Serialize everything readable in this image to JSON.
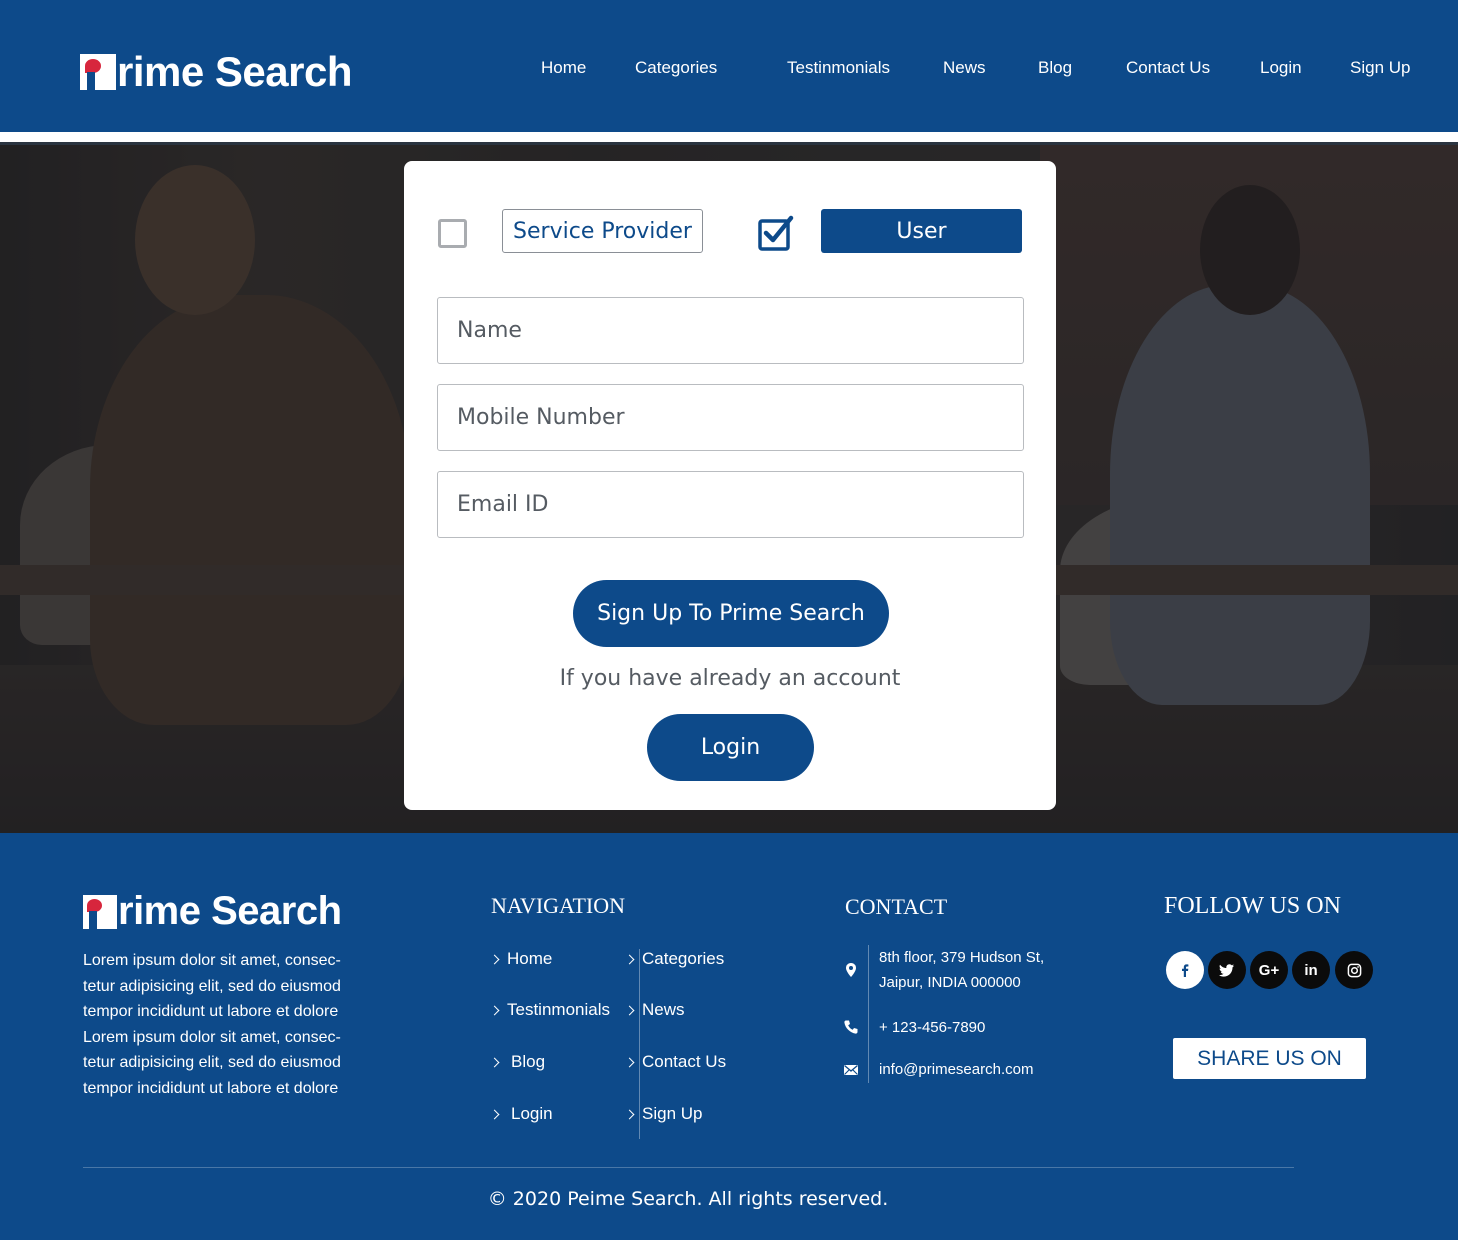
{
  "brand": {
    "name": "rime Search",
    "initial": "P"
  },
  "nav": {
    "home": "Home",
    "categories": "Categories",
    "testimonials": "Testinmonials",
    "news": "News",
    "blog": "Blog",
    "contact": "Contact Us",
    "login": "Login",
    "signup": "Sign Up"
  },
  "form": {
    "role_provider": "Service Provider",
    "role_user": "User",
    "provider_checked": false,
    "user_checked": true,
    "name_placeholder": "Name",
    "mobile_placeholder": "Mobile Number",
    "email_placeholder": "Email ID",
    "signup_button": "Sign Up To Prime Search",
    "already_text": "If you have already an account",
    "login_button": "Login"
  },
  "footer": {
    "about_lines": [
      "Lorem ipsum dolor sit amet, consec-",
      "tetur adipisicing elit, sed do eiusmod",
      "tempor incididunt ut labore et dolore",
      "Lorem ipsum dolor sit amet, consec-",
      "tetur adipisicing elit, sed do eiusmod",
      "tempor incididunt ut labore et dolore"
    ],
    "navigation_heading": "NAVIGATION",
    "nav_links": {
      "home": "Home",
      "categories": "Categories",
      "testimonials": "Testinmonials",
      "news": "News",
      "blog": "Blog",
      "contact": "Contact Us",
      "login": "Login",
      "signup": "Sign Up"
    },
    "contact_heading": "CONTACT",
    "address_line1": "8th floor, 379 Hudson St,",
    "address_line2": "Jaipur, INDIA 000000",
    "phone": "+ 123-456-7890",
    "email": "info@primesearch.com",
    "follow_heading": "FOLLOW US ON",
    "social": {
      "facebook": "f",
      "twitter": "t",
      "google": "G+",
      "linkedin": "in",
      "instagram": "ig"
    },
    "share_button": "SHARE US ON",
    "copyright": "© 2020  Peime Search. All rights reserved."
  },
  "colors": {
    "brand_blue": "#0d4a8a",
    "white": "#ffffff",
    "logo_red": "#d7263d"
  }
}
